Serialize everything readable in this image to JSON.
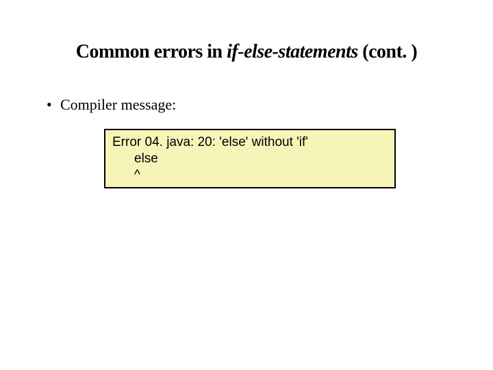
{
  "title": {
    "prefix": "Common errors in ",
    "italic": "if-else-statements",
    "suffix": " (cont. )"
  },
  "bullet": {
    "marker": "•",
    "text": "Compiler message:"
  },
  "codebox": {
    "line1": "Error 04. java: 20: 'else' without 'if'",
    "line2": "else",
    "line3": "^"
  }
}
